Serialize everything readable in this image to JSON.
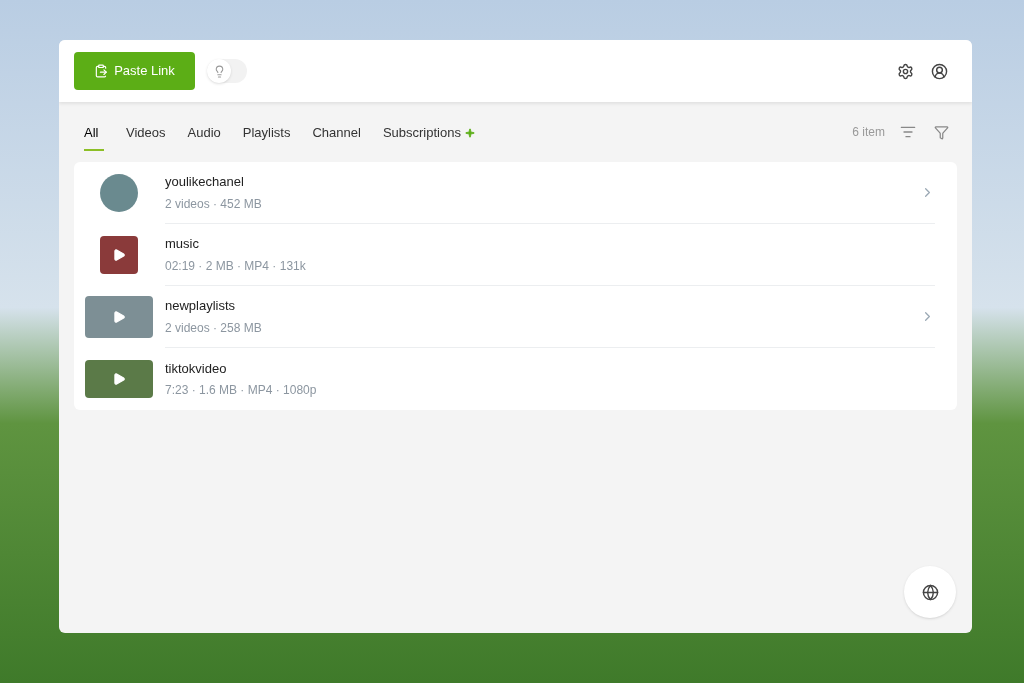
{
  "toolbar": {
    "paste_button": "Paste Link",
    "bulb_toggle": {
      "on": false
    }
  },
  "tabs": [
    {
      "label": "All",
      "selected": true
    },
    {
      "label": "Videos",
      "selected": false
    },
    {
      "label": "Audio",
      "selected": false
    },
    {
      "label": "Playlists",
      "selected": false
    },
    {
      "label": "Channel",
      "selected": false
    },
    {
      "label": "Subscriptions",
      "selected": false
    }
  ],
  "item_count": "6 item",
  "items": [
    {
      "kind": "channel",
      "title": "youlikechanel",
      "details": "2 videos · 452 MB"
    },
    {
      "kind": "audio",
      "title": "music",
      "details": "02:19 · 2 MB · MP4 · 131k"
    },
    {
      "kind": "playlist",
      "title": "newplaylists",
      "details": "2 videos · 258 MB"
    },
    {
      "kind": "video",
      "title": "tiktokvideo",
      "details": "7:23 · 1.6 MB · MP4 · 1080p"
    }
  ]
}
